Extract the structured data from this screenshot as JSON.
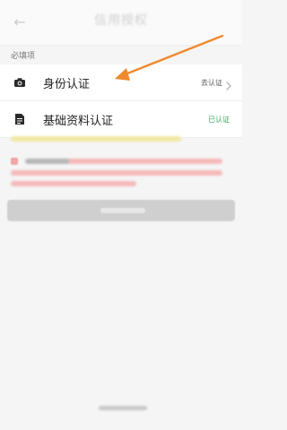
{
  "header": {
    "title": "信用授权",
    "back_icon": "back-arrow-icon"
  },
  "section": {
    "label": "必填项"
  },
  "items": [
    {
      "label": "身份认证",
      "status": "去认证",
      "status_color": "#555555",
      "icon": "camera-icon"
    },
    {
      "label": "基础资料认证",
      "status": "已认证",
      "status_color": "#3ba55c",
      "icon": "document-icon"
    }
  ],
  "colors": {
    "annotation_arrow": "#f0892d",
    "verified": "#3ba55c"
  }
}
